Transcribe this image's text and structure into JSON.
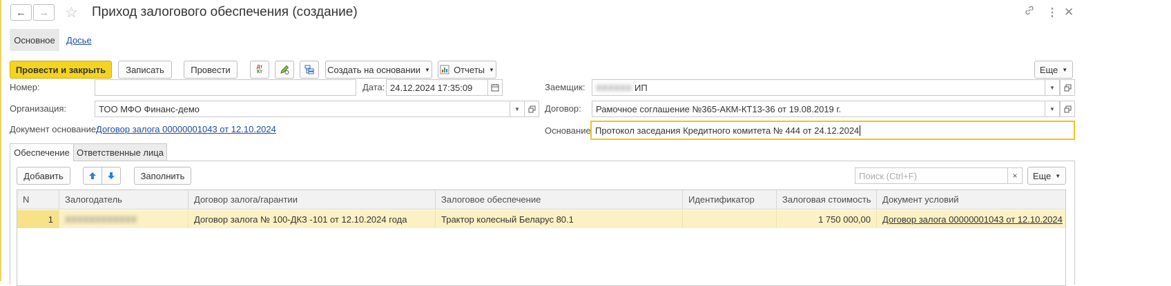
{
  "window": {
    "title": "Приход залогового обеспечения (создание)"
  },
  "sections": {
    "main": "Основное",
    "dossier": "Досье"
  },
  "toolbar": {
    "post_close": "Провести и закрыть",
    "save": "Записать",
    "post": "Провести",
    "dtkt_icon": "Дт Кт",
    "create_based": "Создать на основании",
    "reports": "Отчеты",
    "more": "Еще"
  },
  "form": {
    "number_label": "Номер:",
    "number_value": "",
    "date_label": "Дата:",
    "date_value": "24.12.2024 17:35:09",
    "org_label": "Организация:",
    "org_value": "ТОО МФО Финанс-демо",
    "doc_basis_label": "Документ основание:",
    "doc_basis_link": "Договор залога 00000001043 от 12.10.2024",
    "borrower_label": "Заемщик:",
    "borrower_hidden": "XXXXXX",
    "borrower_value": "ИП",
    "contract_label": "Договор:",
    "contract_value": "Рамочное соглашение №365-АКМ-КТ13-36 от 19.08.2019 г.",
    "reason_label": "Основание:",
    "reason_value": "Протокол заседания Кредитного комитета № 444 от 24.12.2024"
  },
  "tabs": {
    "collateral": "Обеспечение",
    "responsible": "Ответственные лица"
  },
  "table_toolbar": {
    "add": "Добавить",
    "fill": "Заполнить",
    "search_placeholder": "Поиск (Ctrl+F)",
    "clear": "×",
    "more": "Еще"
  },
  "table": {
    "columns": [
      "N",
      "Залогодатель",
      "Договор залога/гарантии",
      "Залоговое обеспечение",
      "Идентификатор",
      "Залоговая стоимость",
      "Документ условий"
    ],
    "rows": [
      {
        "n": "1",
        "pledger": "XXXXXXXXXXXX",
        "contract": "Договор залога № 100-ДКЗ -101 от 12.10.2024 года",
        "collateral": "Трактор колесный Беларус 80.1",
        "identifier": "",
        "value": "1 750 000,00",
        "conditions_doc": "Договор залога 00000001043 от 12.10.2024"
      }
    ]
  },
  "colors": {
    "primary_button": "#f5d420",
    "selected_row": "#fbf1c4",
    "focus_border": "#f0c419",
    "link": "#1a4ea0"
  }
}
